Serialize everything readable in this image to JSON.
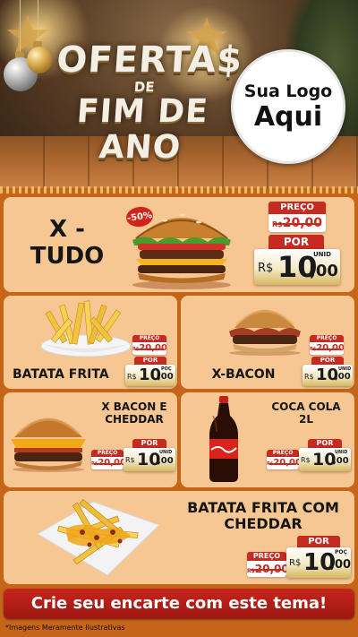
{
  "header": {
    "title_line1": "OFERTA$",
    "title_line2": "DE",
    "title_line3": "FIM DE ANO",
    "logo_line1": "Sua Logo",
    "logo_line2": "Aqui"
  },
  "labels": {
    "preco": "PREÇO",
    "por": "POR",
    "currency": "R$"
  },
  "products": [
    {
      "name_line1": "X -",
      "name_line2": "TUDO",
      "old_price": "20,00",
      "price_int": "10",
      "price_cents": ",00",
      "unit": "UNID",
      "discount": "-50%"
    },
    {
      "name_line1": "BATATA FRITA",
      "old_price": "20,00",
      "price_int": "10",
      "price_cents": ",00",
      "unit": "POÇ"
    },
    {
      "name_line1": "X-BACON",
      "old_price": "20,00",
      "price_int": "10",
      "price_cents": ",00",
      "unit": "UNID"
    },
    {
      "name_line1": "X BACON E",
      "name_line2": "CHEDDAR",
      "old_price": "20,00",
      "price_int": "10",
      "price_cents": ",00",
      "unit": "UNID"
    },
    {
      "name_line1": "COCA COLA",
      "name_line2": "2L",
      "old_price": "20,00",
      "price_int": "10",
      "price_cents": ",00",
      "unit": "UNID"
    },
    {
      "name_line1": "BATATA FRITA COM",
      "name_line2": "CHEDDAR",
      "old_price": "20,00",
      "price_int": "10",
      "price_cents": ",00",
      "unit": "POÇ"
    }
  ],
  "cta": "Crie seu encarte com este tema!",
  "disclaimer": "*Imagens Meramente Ilustrativas",
  "colors": {
    "background": "#c5651a",
    "card": "#f7c793",
    "accent_red": "#c62b21"
  }
}
